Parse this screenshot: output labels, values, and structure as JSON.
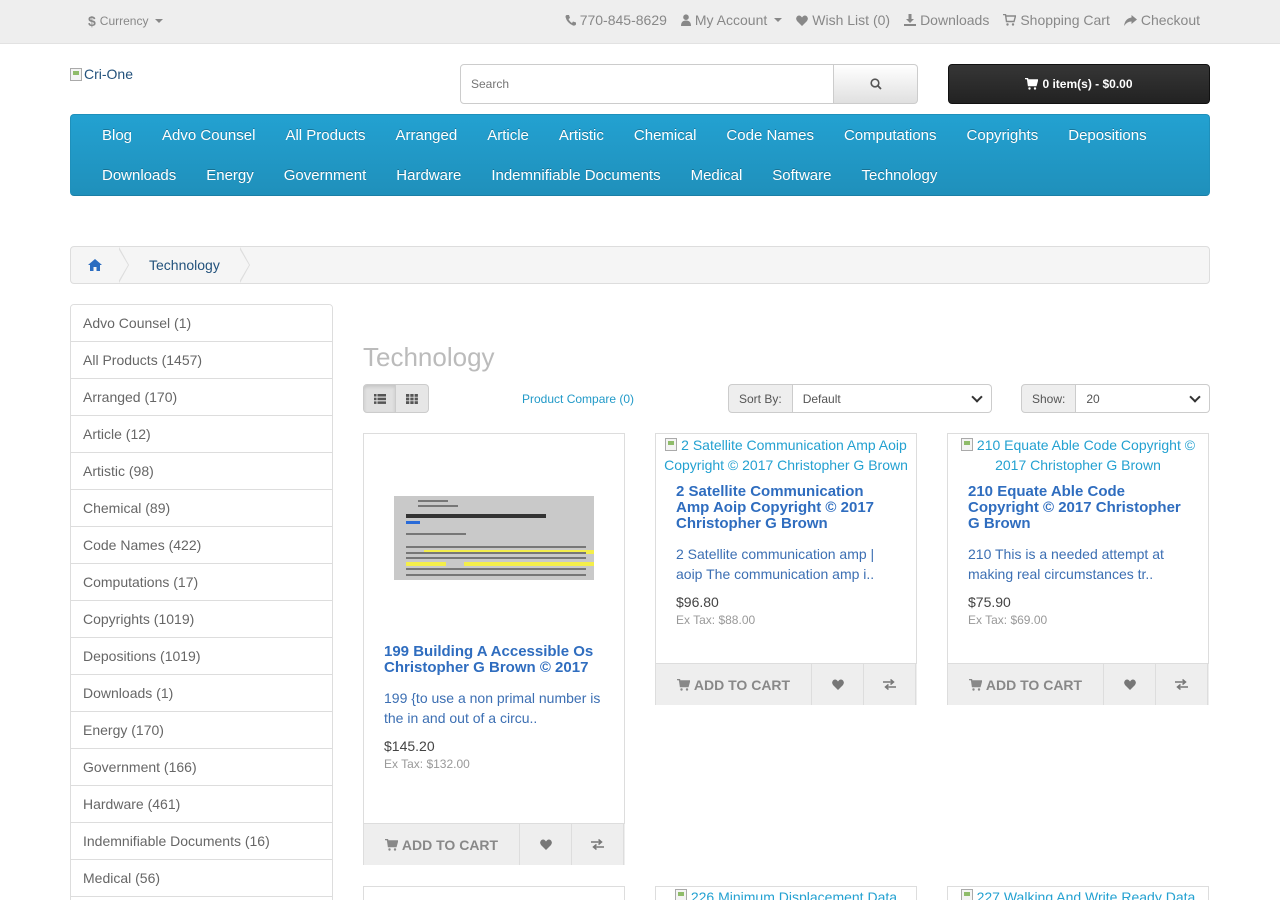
{
  "topbar": {
    "currency_symbol": "$",
    "currency_label": "Currency",
    "phone": "770-845-8629",
    "my_account": "My Account",
    "wish_list": "Wish List (0)",
    "downloads": "Downloads",
    "shopping_cart": "Shopping Cart",
    "checkout": "Checkout"
  },
  "header": {
    "logo_alt": "Cri-One",
    "search_placeholder": "Search",
    "cart_label": "0 item(s) - $0.00"
  },
  "nav": {
    "row1": [
      "Blog",
      "Advo Counsel",
      "All Products",
      "Arranged",
      "Article",
      "Artistic",
      "Chemical",
      "Code Names",
      "Computations",
      "Copyrights",
      "Depositions"
    ],
    "row2": [
      "Downloads",
      "Energy",
      "Government",
      "Hardware",
      "Indemnifiable Documents",
      "Medical",
      "Software",
      "Technology"
    ]
  },
  "breadcrumb": {
    "current": "Technology"
  },
  "sidebar": {
    "items": [
      "Advo Counsel (1)",
      "All Products (1457)",
      "Arranged (170)",
      "Article (12)",
      "Artistic (98)",
      "Chemical (89)",
      "Code Names (422)",
      "Computations (17)",
      "Copyrights (1019)",
      "Depositions (1019)",
      "Downloads (1)",
      "Energy (170)",
      "Government (166)",
      "Hardware (461)",
      "Indemnifiable Documents (16)",
      "Medical (56)"
    ]
  },
  "main": {
    "title": "Technology",
    "compare_link": "Product Compare (0)",
    "sort_label": "Sort By:",
    "sort_value": "Default",
    "show_label": "Show:",
    "show_value": "20"
  },
  "buttons": {
    "add_to_cart": "ADD TO CART"
  },
  "products": [
    {
      "name": "199 Building A Accessible Os Christopher G Brown © 2017",
      "desc": "199 {to use a non primal number is the in and out of a circu..",
      "price": "$145.20",
      "ex_tax": "Ex Tax: $132.00"
    },
    {
      "img_alt": "2 Satellite Communication Amp Aoip Copyright © 2017 Christopher G Brown",
      "name": "2 Satellite Communication Amp Aoip Copyright © 2017 Christopher G Brown",
      "desc": "2 Satellite communication amp | aoip The communication amp i..",
      "price": "$96.80",
      "ex_tax": "Ex Tax: $88.00"
    },
    {
      "img_alt": "210 Equate Able Code Copyright © 2017 Christopher G Brown",
      "name": "210 Equate Able Code Copyright © 2017 Christopher G Brown",
      "desc": "210 This is a needed attempt at making real circumstances tr..",
      "price": "$75.90",
      "ex_tax": "Ex Tax: $69.00"
    }
  ],
  "next_row": [
    {
      "img_alt": "226 Minimum Displacement Data"
    },
    {
      "img_alt": "227 Walking And Write Ready Data"
    }
  ],
  "colors": {
    "nav_blue": "#23a1d1",
    "link_blue": "#23527c",
    "cart_dark": "#2a2a2a"
  }
}
